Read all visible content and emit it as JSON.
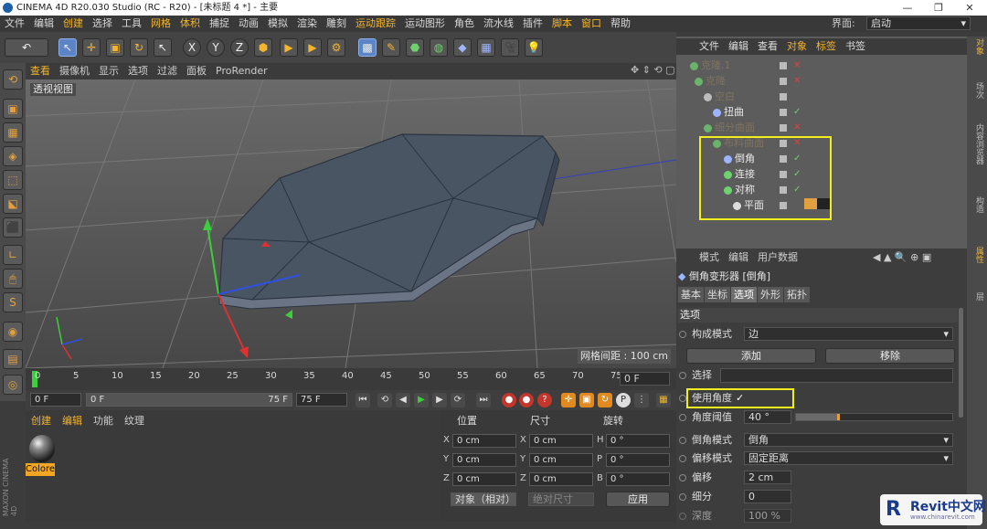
{
  "window": {
    "title": "CINEMA 4D R20.030 Studio (RC - R20) - [未标题 4 *] - 主要",
    "min": "—",
    "restore": "❐",
    "close": "✕"
  },
  "menubar": {
    "items": [
      "文件",
      "编辑",
      "创建",
      "选择",
      "工具",
      "网格",
      "体积",
      "捕捉",
      "动画",
      "模拟",
      "渲染",
      "雕刻",
      "运动跟踪",
      "运动图形",
      "角色",
      "流水线",
      "插件",
      "脚本",
      "窗口",
      "帮助"
    ],
    "layout_label": "界面:",
    "layout_value": "启动"
  },
  "toolbar": {
    "undo": "↶",
    "axes": [
      "X",
      "Y",
      "Z"
    ]
  },
  "viewport": {
    "menu": [
      "查看",
      "摄像机",
      "显示",
      "选项",
      "过滤",
      "面板",
      "ProRender"
    ],
    "label": "透视视图",
    "grid_spacing": "网格间距 : 100 cm"
  },
  "timeline": {
    "ticks": [
      "0",
      "5",
      "10",
      "15",
      "20",
      "25",
      "30",
      "35",
      "40",
      "45",
      "50",
      "55",
      "60",
      "65",
      "70",
      "75"
    ],
    "current_frame": "0 F",
    "start": "0 F",
    "range_start": "0 F",
    "range_end": "75 F",
    "end": "75 F"
  },
  "material": {
    "menu": [
      "创建",
      "编辑",
      "功能",
      "纹理"
    ],
    "name": "Colore"
  },
  "coords": {
    "headers": [
      "位置",
      "尺寸",
      "旋转"
    ],
    "pos": [
      {
        "axis": "X",
        "value": "0 cm"
      },
      {
        "axis": "Y",
        "value": "0 cm"
      },
      {
        "axis": "Z",
        "value": "0 cm"
      }
    ],
    "size": [
      {
        "axis": "X",
        "value": "0 cm"
      },
      {
        "axis": "Y",
        "value": "0 cm"
      },
      {
        "axis": "Z",
        "value": "0 cm"
      }
    ],
    "rot": [
      {
        "axis": "H",
        "value": "0 °"
      },
      {
        "axis": "P",
        "value": "0 °"
      },
      {
        "axis": "B",
        "value": "0 °"
      }
    ],
    "mode": "对象（相对）",
    "size_mode": "绝对尺寸",
    "apply": "应用"
  },
  "objects": {
    "menu": [
      "文件",
      "编辑",
      "查看",
      "对象",
      "标签",
      "书签"
    ],
    "tree": [
      {
        "name": "克隆.1",
        "dim": true
      },
      {
        "name": "克隆",
        "dim": true
      },
      {
        "name": "空白",
        "dim": true
      },
      {
        "name": "扭曲",
        "dim": false
      },
      {
        "name": "细分曲面",
        "dim": true
      },
      {
        "name": "布料曲面",
        "dim": true
      },
      {
        "name": "倒角",
        "dim": false
      },
      {
        "name": "连接",
        "dim": false
      },
      {
        "name": "对称",
        "dim": false
      },
      {
        "name": "平面",
        "dim": false
      }
    ]
  },
  "attributes": {
    "menu": [
      "模式",
      "编辑",
      "用户数据"
    ],
    "title": "倒角变形器 [倒角]",
    "tabs": [
      "基本",
      "坐标",
      "选项",
      "外形",
      "拓扑"
    ],
    "active_tab": "选项",
    "section": "选项",
    "component_mode_label": "构成模式",
    "component_mode_value": "边",
    "add_button": "添加",
    "remove_button": "移除",
    "selection_label": "选择",
    "use_angle_label": "使用角度",
    "use_angle_check": "✓",
    "angle_threshold_label": "角度阈值",
    "angle_threshold_value": "40 °",
    "angle_threshold_level": 0.28,
    "bevel_mode_label": "倒角模式",
    "bevel_mode_value": "倒角",
    "offset_mode_label": "偏移模式",
    "offset_mode_value": "固定距离",
    "offset_label": "偏移",
    "offset_value": "2 cm",
    "subdiv_label": "细分",
    "subdiv_value": "0",
    "depth_label": "深度",
    "depth_value": "100 %"
  },
  "right_tabs": [
    "对象",
    "场次",
    "内容浏览器",
    "构造",
    "属性",
    "层"
  ],
  "watermark": {
    "brand": "Revit中文网",
    "url": "www.chinarevit.com"
  }
}
